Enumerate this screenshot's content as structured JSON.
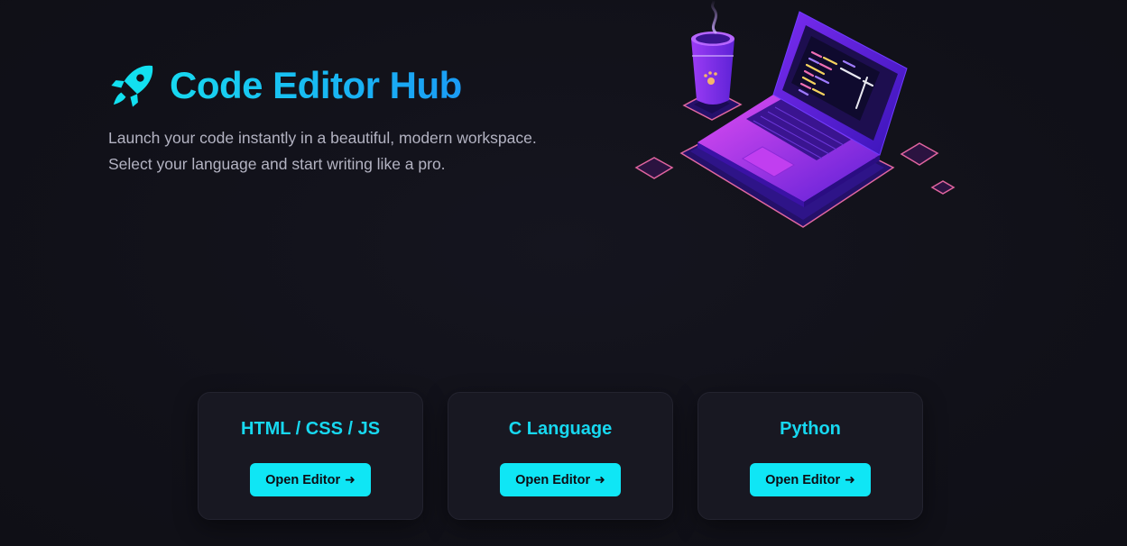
{
  "hero": {
    "title": "Code Editor Hub",
    "icon": "rocket-icon",
    "subtitle": "Launch your code instantly in a beautiful, modern workspace. Select your language and start writing like a pro."
  },
  "illustration": {
    "icon": "laptop-coffee-illustration"
  },
  "cards": [
    {
      "title": "HTML / CSS / JS",
      "button_label": "Open Editor",
      "button_icon": "➜"
    },
    {
      "title": "C Language",
      "button_label": "Open Editor",
      "button_icon": "➜"
    },
    {
      "title": "Python",
      "button_label": "Open Editor",
      "button_icon": "➜"
    }
  ],
  "colors": {
    "background": "#111119",
    "accent": "#17d8f0",
    "button": "#0fe6f5",
    "card": "#181822"
  }
}
